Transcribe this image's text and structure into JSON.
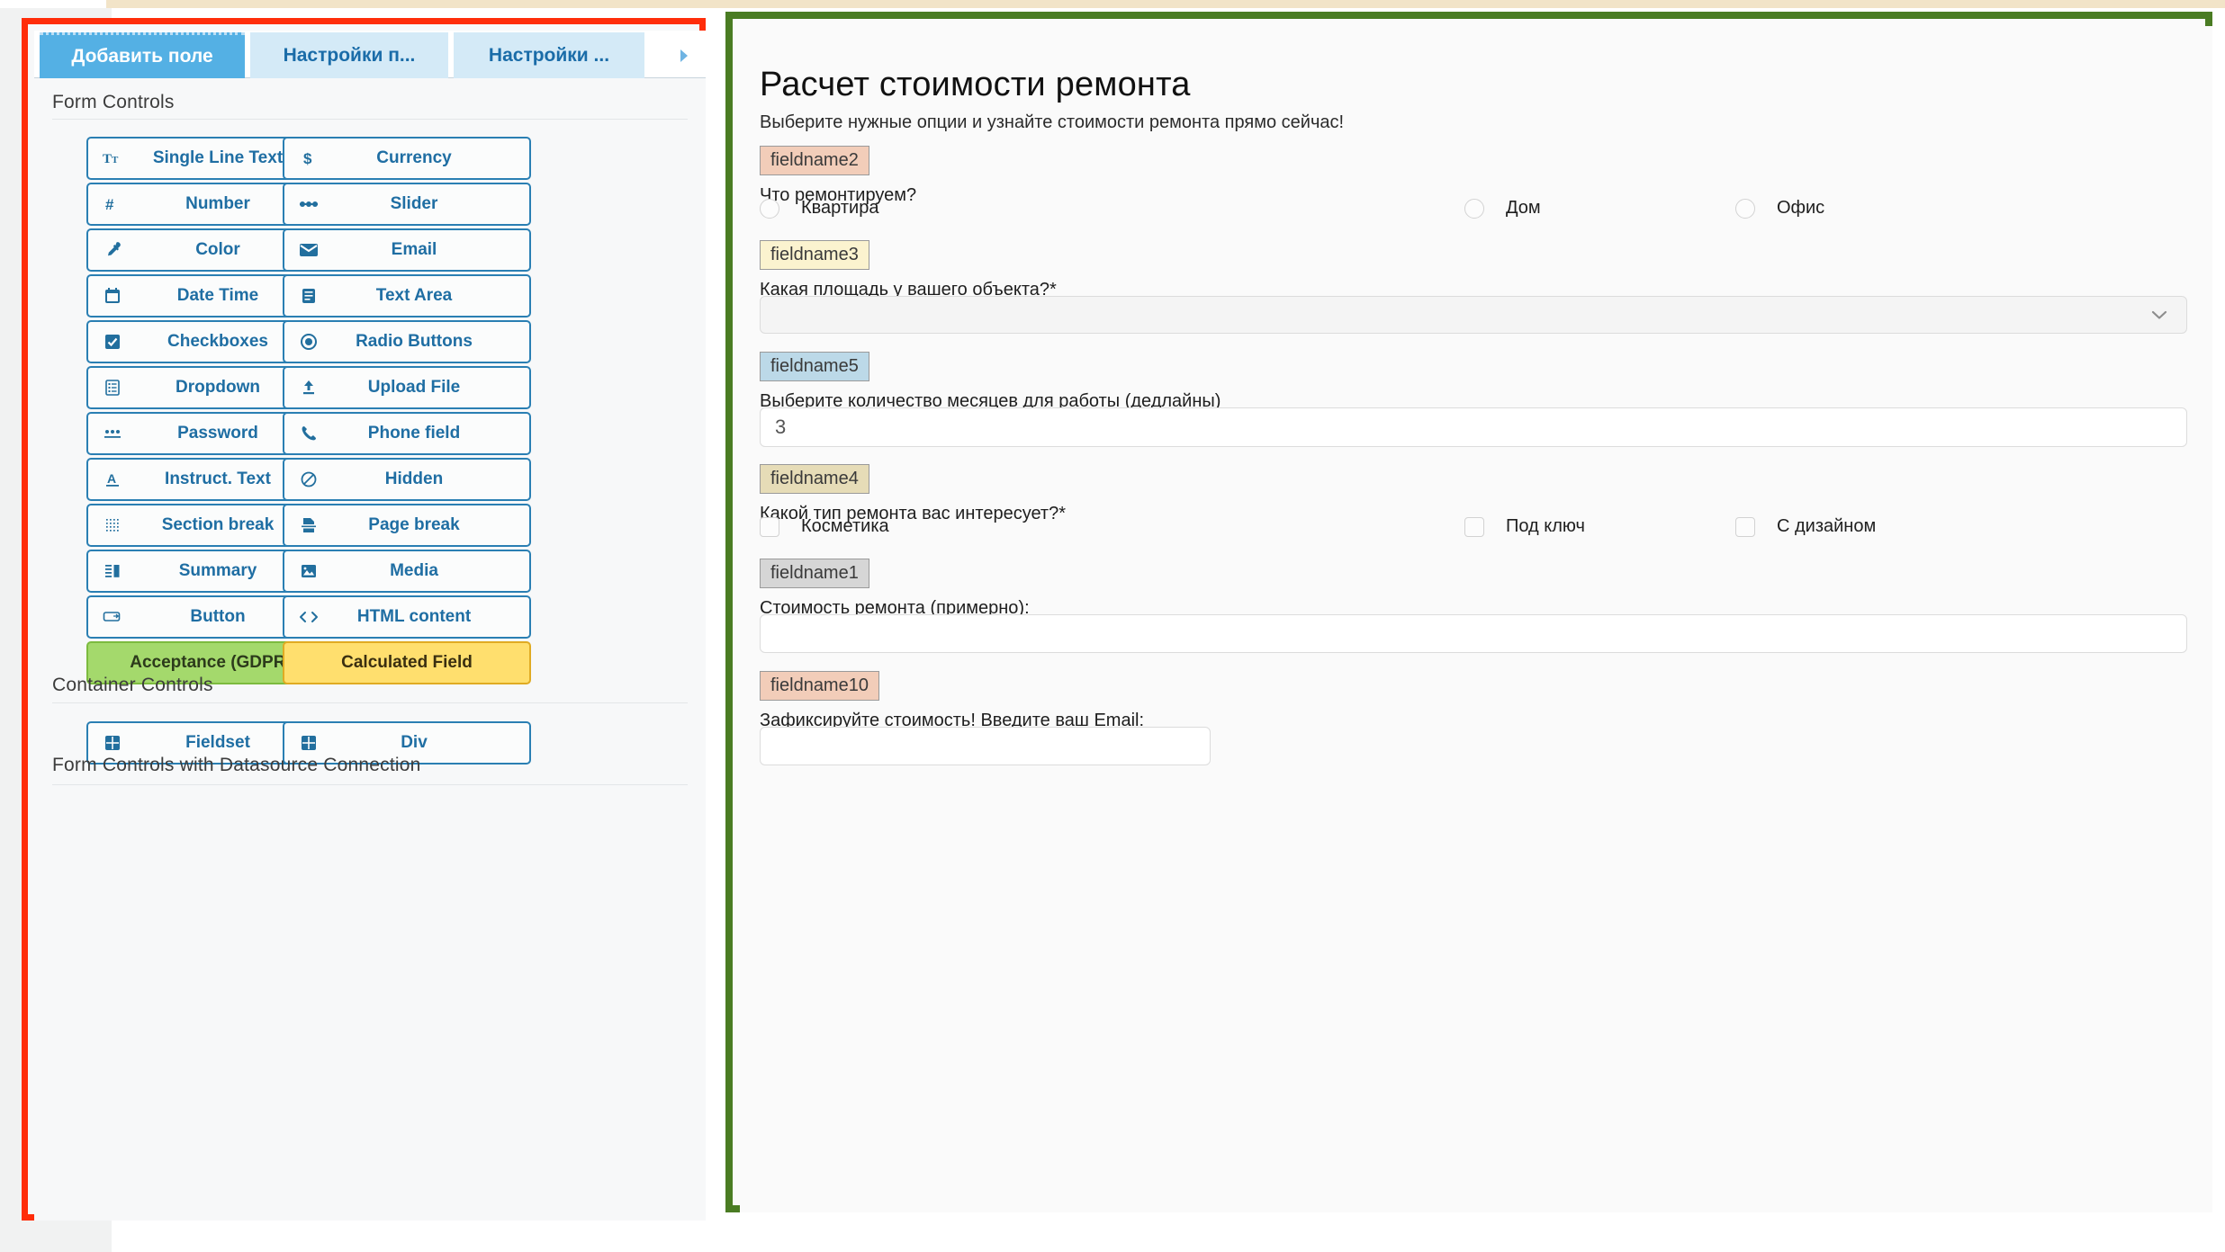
{
  "builder": {
    "tabs": [
      {
        "label": "Добавить поле",
        "active": true
      },
      {
        "label": "Настройки п...",
        "active": false
      },
      {
        "label": "Настройки ...",
        "active": false
      }
    ],
    "tab_overflow_icon": "chevron-right-icon",
    "sections": [
      {
        "title": "Form Controls"
      },
      {
        "title": "Container Controls"
      },
      {
        "title": "Form Controls with Datasource Connection"
      }
    ],
    "form_controls": [
      {
        "label": "Single Line Text",
        "icon": "text-size-icon",
        "style": "default"
      },
      {
        "label": "Currency",
        "icon": "dollar-icon",
        "style": "default"
      },
      {
        "label": "Number",
        "icon": "hash-icon",
        "style": "default"
      },
      {
        "label": "Slider",
        "icon": "slider-icon",
        "style": "default"
      },
      {
        "label": "Color",
        "icon": "eyedropper-icon",
        "style": "default"
      },
      {
        "label": "Email",
        "icon": "envelope-icon",
        "style": "default"
      },
      {
        "label": "Date Time",
        "icon": "calendar-icon",
        "style": "default"
      },
      {
        "label": "Text Area",
        "icon": "textarea-icon",
        "style": "default"
      },
      {
        "label": "Checkboxes",
        "icon": "checkbox-icon",
        "style": "default"
      },
      {
        "label": "Radio Buttons",
        "icon": "radio-icon",
        "style": "default"
      },
      {
        "label": "Dropdown",
        "icon": "list-icon",
        "style": "default"
      },
      {
        "label": "Upload File",
        "icon": "upload-icon",
        "style": "default"
      },
      {
        "label": "Password",
        "icon": "password-dots-icon",
        "style": "default"
      },
      {
        "label": "Phone field",
        "icon": "phone-icon",
        "style": "default"
      },
      {
        "label": "Instruct. Text",
        "icon": "underline-a-icon",
        "style": "default"
      },
      {
        "label": "Hidden",
        "icon": "eye-slash-icon",
        "style": "default"
      },
      {
        "label": "Section break",
        "icon": "dotted-grid-icon",
        "style": "default"
      },
      {
        "label": "Page break",
        "icon": "page-break-icon",
        "style": "default"
      },
      {
        "label": "Summary",
        "icon": "summary-icon",
        "style": "default"
      },
      {
        "label": "Media",
        "icon": "image-icon",
        "style": "default"
      },
      {
        "label": "Button",
        "icon": "button-icon",
        "style": "default"
      },
      {
        "label": "HTML content",
        "icon": "code-brackets-icon",
        "style": "default"
      },
      {
        "label": "Acceptance (GDPR)",
        "icon": "none",
        "style": "green"
      },
      {
        "label": "Calculated Field",
        "icon": "none",
        "style": "yellow"
      }
    ],
    "container_controls": [
      {
        "label": "Fieldset",
        "icon": "grid-icon",
        "style": "default"
      },
      {
        "label": "Div",
        "icon": "grid-icon",
        "style": "default"
      }
    ],
    "colors": {
      "panel_outline": "#ff2d0a",
      "tab_active_bg": "#54b0e4",
      "tab_inactive_bg": "#d4eaf7",
      "button_border": "#2a7fb3",
      "button_text": "#1f6ea3",
      "gdpr_bg": "#a4d96c",
      "calculated_bg": "#ffdf6e"
    }
  },
  "preview": {
    "outline_color": "#4a7c23",
    "title": "Расчет стоимости ремонта",
    "subtitle": "Выберите нужные опции и узнайте стоимости ремонта прямо сейчас!",
    "fields": [
      {
        "badge": "fieldname2",
        "badge_color": "#f2cdb9",
        "label": "Что ремонтируем?",
        "type": "radio",
        "options": [
          "Квартира",
          "Дом",
          "Офис"
        ]
      },
      {
        "badge": "fieldname3",
        "badge_color": "#fbf3cf",
        "label": "Какая площадь у вашего объекта?*",
        "type": "select",
        "value": "",
        "chevron_icon": "chevron-down-icon"
      },
      {
        "badge": "fieldname5",
        "badge_color": "#bcd9e8",
        "label": "Выберите количество месяцев для работы (дедлайны)",
        "type": "number",
        "value": "3"
      },
      {
        "badge": "fieldname4",
        "badge_color": "#e6dcb7",
        "label": "Какой тип ремонта вас интересует?*",
        "type": "checkbox",
        "options": [
          "Косметика",
          "Под ключ",
          "С дизайном"
        ]
      },
      {
        "badge": "fieldname1",
        "badge_color": "#d6d6d6",
        "label": "Стоимость ремонта (примерно):",
        "type": "text",
        "value": ""
      },
      {
        "badge": "fieldname10",
        "badge_color": "#f2cdb9",
        "label": "Зафиксируйте стоимость! Введите ваш Email:",
        "type": "email",
        "value": ""
      }
    ]
  }
}
